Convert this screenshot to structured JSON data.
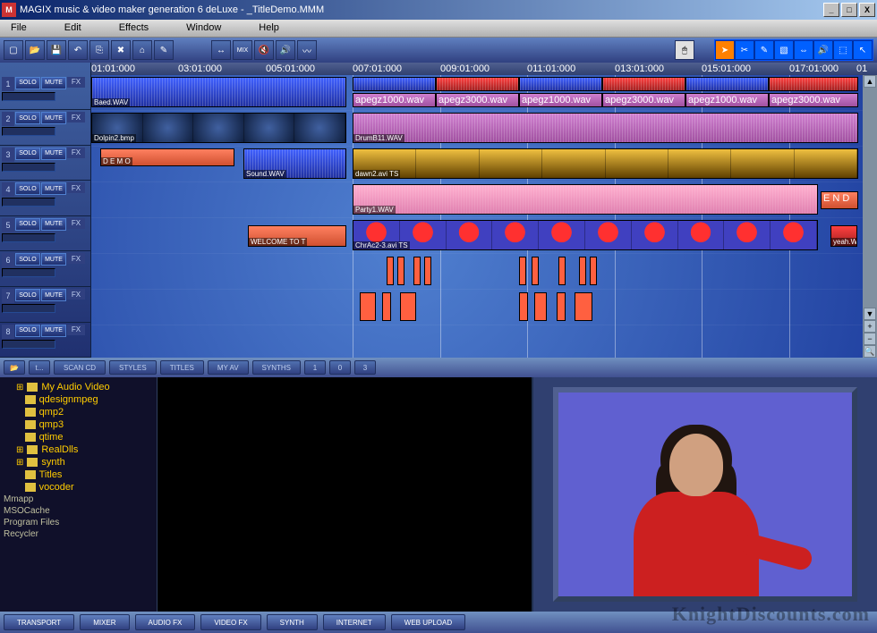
{
  "window": {
    "title": "MAGIX music & video maker generation 6 deLuxe - _TitleDemo.MMM",
    "min": "_",
    "max": "□",
    "close": "X"
  },
  "menu": {
    "file": "File",
    "edit": "Edit",
    "effects": "Effects",
    "window": "Window",
    "help": "Help"
  },
  "ruler": [
    "01:01:000",
    "03:01:000",
    "005:01:000",
    "007:01:000",
    "009:01:000",
    "011:01:000",
    "013:01:000",
    "015:01:000",
    "017:01:000",
    "01"
  ],
  "track_labels": {
    "solo": "SOLO",
    "mute": "MUTE",
    "fx": "FX"
  },
  "clips": {
    "baed": "Baed.WAV",
    "dolphin": "Dolpin2.bmp",
    "demo": "D E M O",
    "sound": "Sound.WAV",
    "welcome": "WELCOME TO T",
    "apegz1": "apegz1000.wav",
    "apegz3": "apegz3000.wav",
    "drumb": "DrumB11.WAV",
    "dawn": "dawn2.avi TS",
    "party": "Party1.WAV",
    "chrac": "ChrAc2-3.avi TS",
    "end": "E N D",
    "yeah": "yeah.WA"
  },
  "mid": {
    "scan": "SCAN CD",
    "styles": "STYLES",
    "titles": "TITLES",
    "myav": "MY AV",
    "synths": "SYNTHS",
    "n1": "1",
    "n2": "0",
    "n3": "3",
    "t": "t..."
  },
  "tree": {
    "items": [
      "My Audio Video",
      "qdesignmpeg",
      "qmp2",
      "qmp3",
      "qtime",
      "RealDlls",
      "synth",
      "Titles",
      "vocoder"
    ],
    "roots": [
      "Mmapp",
      "MSOCache",
      "Program Files",
      "Recycler"
    ]
  },
  "bottom": {
    "transport": "TRANSPORT",
    "mixer": "MIXER",
    "audiofx": "AUDIO FX",
    "videofx": "VIDEO FX",
    "synth": "SYNTH",
    "internet": "INTERNET",
    "web": "WEB UPLOAD"
  },
  "watermark": "KnightDiscounts.com",
  "zoom": {
    "plus": "+",
    "minus": "−"
  },
  "scroll": {
    "up": "▲",
    "down": "▼"
  }
}
